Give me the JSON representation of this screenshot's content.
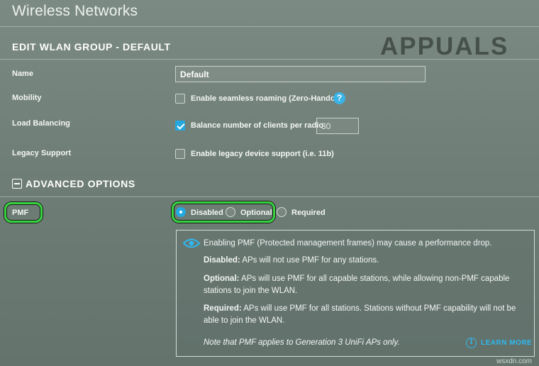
{
  "page": {
    "title": "Wireless Networks"
  },
  "edit_section": {
    "title": "EDIT WLAN GROUP - DEFAULT"
  },
  "fields": {
    "name": {
      "label": "Name",
      "value": "Default"
    },
    "mobility": {
      "label": "Mobility",
      "checkbox_label": "Enable seamless roaming (Zero-Handoff)",
      "checked": false,
      "help_icon": "question-circle-icon",
      "help_glyph": "?"
    },
    "load_balancing": {
      "label": "Load Balancing",
      "checkbox_label": "Balance number of clients per radio",
      "checked": true,
      "value": "30"
    },
    "legacy_support": {
      "label": "Legacy Support",
      "checkbox_label": "Enable legacy device support (i.e. 11b)",
      "checked": false
    }
  },
  "advanced": {
    "title": "ADVANCED OPTIONS",
    "toggle_icon": "minus-square-icon",
    "pmf": {
      "label": "PMF",
      "options": [
        {
          "label": "Disabled",
          "selected": true
        },
        {
          "label": "Optional",
          "selected": false
        },
        {
          "label": "Required",
          "selected": false
        }
      ]
    }
  },
  "info_box": {
    "icon": "eye-icon",
    "intro": "Enabling PMF (Protected management frames) may cause a performance drop.",
    "disabled_term": "Disabled:",
    "disabled_text": " APs will not use PMF for any stations.",
    "optional_term": "Optional:",
    "optional_text": " APs will use PMF for all capable stations, while allowing non-PMF capable stations to join the WLAN.",
    "required_term": "Required:",
    "required_text": " APs will use PMF for all stations. Stations without PMF capability will not be able to join the WLAN.",
    "note": "Note that PMF applies to Generation 3 UniFi APs only.",
    "learn_more": "LEARN MORE",
    "learn_more_glyph": "i"
  },
  "watermark": {
    "logo": "APPUALS",
    "site": "wsxdn.com"
  },
  "colors": {
    "accent": "#23a9df",
    "highlight": "#35d43f",
    "link": "#30b8f0"
  }
}
